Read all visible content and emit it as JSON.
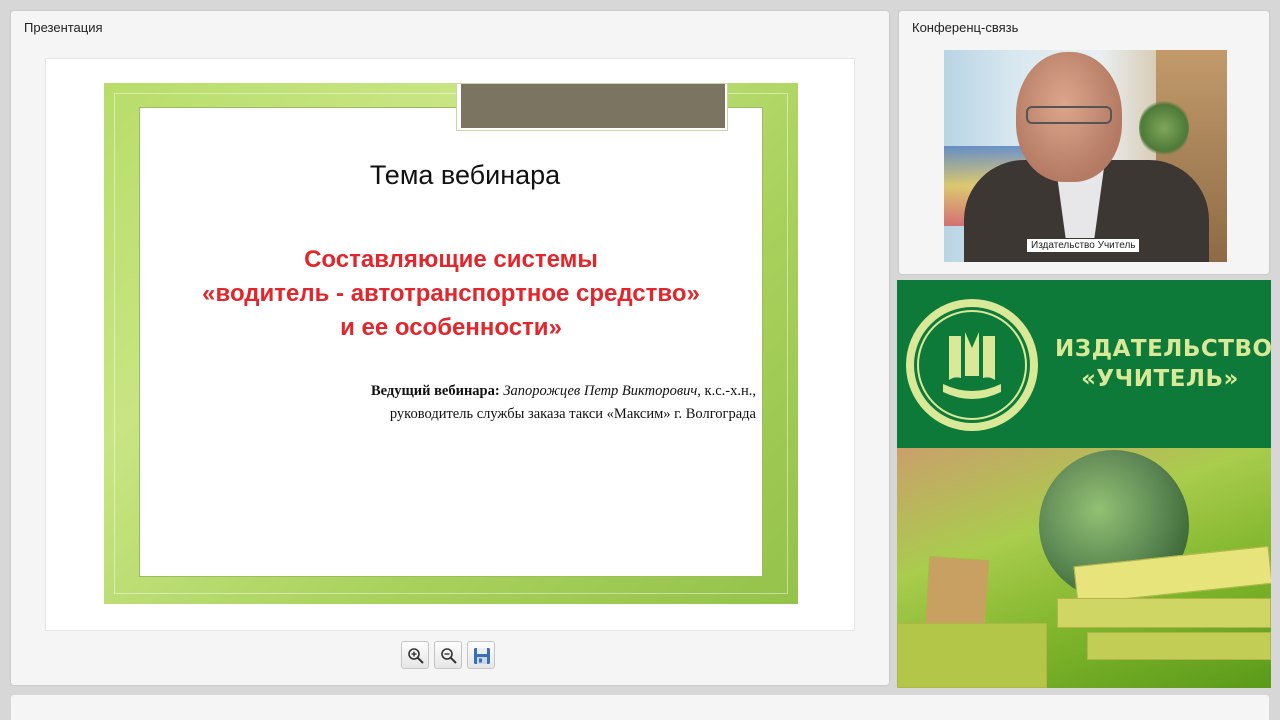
{
  "presentation": {
    "title": "Презентация",
    "slide": {
      "heading": "Тема вебинара",
      "title_lines": [
        "Составляющие системы",
        "«водитель - автотранспортное средство»",
        "и ее особенности»"
      ],
      "presenter_label": "Ведущий вебинара:",
      "presenter_name": "Запорожцев Петр Викторович",
      "presenter_degree": ", к.с.-х.н.,",
      "presenter_position": "руководитель службы заказа такси «Максим» г. Волгограда"
    },
    "toolbar": {
      "zoom_in_icon": "zoom-in-icon",
      "zoom_out_icon": "zoom-out-icon",
      "save_icon": "save-icon"
    }
  },
  "conference": {
    "title": "Конференц-связь",
    "video_label": "Издательство Учитель"
  },
  "banner": {
    "name_line1": "ИЗДАТЕЛЬСТВО",
    "name_line2": "«УЧИТЕЛЬ»",
    "colors": {
      "green": "#0e7a3a",
      "text": "#d9e997"
    }
  }
}
